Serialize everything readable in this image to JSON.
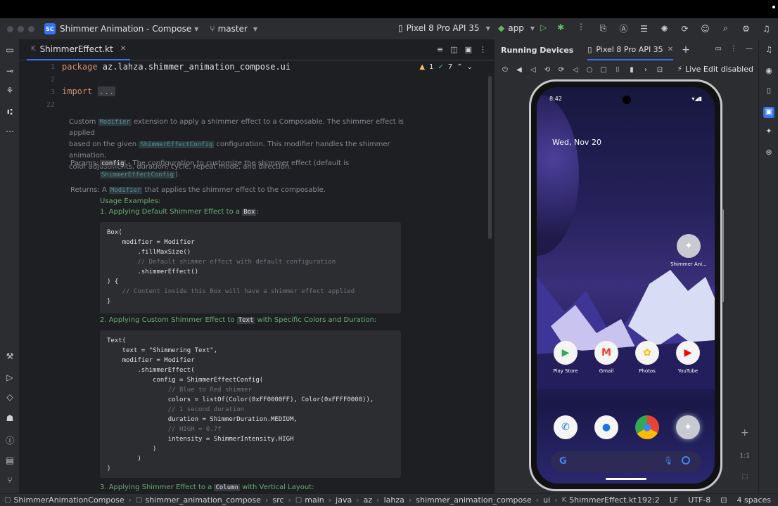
{
  "window": {
    "project_badge": "SC",
    "project_name": "Shimmer Animation - Compose",
    "branch": "master",
    "device": "Pixel 8 Pro API 35",
    "run_config": "app"
  },
  "editor": {
    "tab_name": "ShimmerEffect.kt",
    "tab_ext_badge": "K",
    "warnings": "1",
    "checks": "7",
    "line_numbers": [
      "1",
      "2",
      "3",
      "22"
    ],
    "line1_kw": "package",
    "line1_rest": " az.lahza.shimmer_animation_compose.ui",
    "line3_kw": "import",
    "line3_fold": "...",
    "doc": {
      "p1a": "Custom ",
      "p1_code1": "Modifier",
      "p1b": " extension to apply a shimmer effect to a Composable. The shimmer effect is applied",
      "p1c": "based on the given ",
      "p1_code2": "ShimmerEffectConfig",
      "p1d": " configuration. This modifier handles the shimmer animation,",
      "p1e": "color adjustments, duration, cycle, repeat mode, and direction.",
      "params_label": "Params:",
      "params_code": "config",
      "params_text": " - The configuration to customize the shimmer effect (default is",
      "params_code2": "ShimmerEffectConfig",
      "params_tail": ").",
      "returns_label": "Returns:",
      "returns_a": " A ",
      "returns_code": "Modifier",
      "returns_b": " that applies the shimmer effect to the composable.",
      "usage": "Usage Examples:",
      "ex1_a": "1. Applying Default Shimmer Effect to a ",
      "ex1_code": "Box",
      "ex1_b": ":",
      "ex2_a": "2. Applying Custom Shimmer Effect to ",
      "ex2_code": "Text",
      "ex2_b": " with Specific Colors and Duration:",
      "ex3_a": "3. Applying Shimmer Effect to a ",
      "ex3_code": "Column",
      "ex3_b": " with Vertical Layout:"
    },
    "code1": [
      "Box(",
      "    modifier = Modifier",
      "        .fillMaxSize()",
      "        // Default shimmer effect with default configuration",
      "        .shimmerEffect()",
      ") {",
      "    // Content inside this Box will have a shimmer effect applied",
      "}"
    ],
    "code2": [
      "Text(",
      "    text = \"Shimmering Text\",",
      "    modifier = Modifier",
      "        .shimmerEffect(",
      "            config = ShimmerEffectConfig(",
      "                // Blue to Red shimmer",
      "                colors = listOf(Color(0xFF0000FF), Color(0xFFFF0000)),",
      "                // 1 second duration",
      "                duration = ShimmerDuration.MEDIUM,",
      "                // HIGH = 0.7f",
      "                intensity = ShimmerIntensity.HIGH",
      "            )",
      "        )",
      ")"
    ]
  },
  "running_devices": {
    "title": "Running Devices",
    "device_tab": "Pixel 8 Pro API 35",
    "live_edit": "Live Edit disabled",
    "zoom_label": "1:1"
  },
  "phone": {
    "time": "8:42",
    "date": "Wed, Nov 20",
    "shortcut_label": "Shimmer Ani...",
    "apps": [
      "Play Store",
      "Gmail",
      "Photos",
      "YouTube"
    ]
  },
  "statusbar": {
    "crumbs": [
      "ShimmerAnimationCompose",
      "shimmer_animation_compose",
      "src",
      "main",
      "java",
      "az",
      "lahza",
      "shimmer_animation_compose",
      "ui",
      "ShimmerEffect.kt"
    ],
    "position": "192:2",
    "line_sep": "LF",
    "encoding": "UTF-8",
    "indent": "4 spaces"
  }
}
